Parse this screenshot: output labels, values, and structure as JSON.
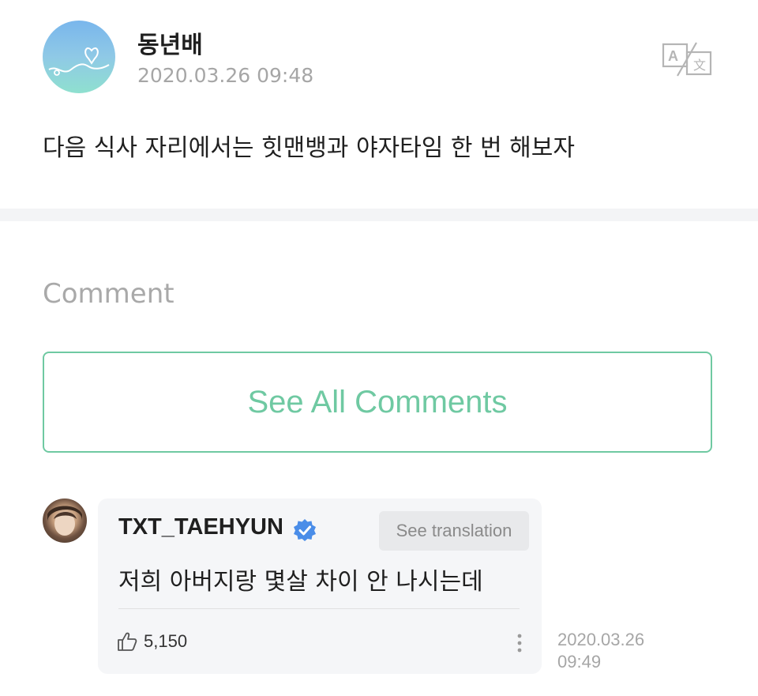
{
  "post": {
    "author": "동년배",
    "timestamp": "2020.03.26 09:48",
    "body": "다음 식사 자리에서는 힛맨뱅과 야자타임 한 번 해보자",
    "translate_icon": "translate-icon"
  },
  "comments_section": {
    "heading": "Comment",
    "see_all_label": "See All Comments"
  },
  "comment": {
    "author": "TXT_TAEHYUN",
    "verified_icon": "verified-badge-icon",
    "see_translation_label": "See translation",
    "body": "저희 아버지랑 몇살 차이 안 나시는데",
    "likes": "5,150",
    "like_icon": "thumbs-up-icon",
    "more_icon": "more-vertical-icon",
    "timestamp": "2020.03.26\n09:49"
  },
  "colors": {
    "accent": "#6fc9a2",
    "verified": "#4a8de8",
    "muted_text": "#a6a6a6"
  }
}
